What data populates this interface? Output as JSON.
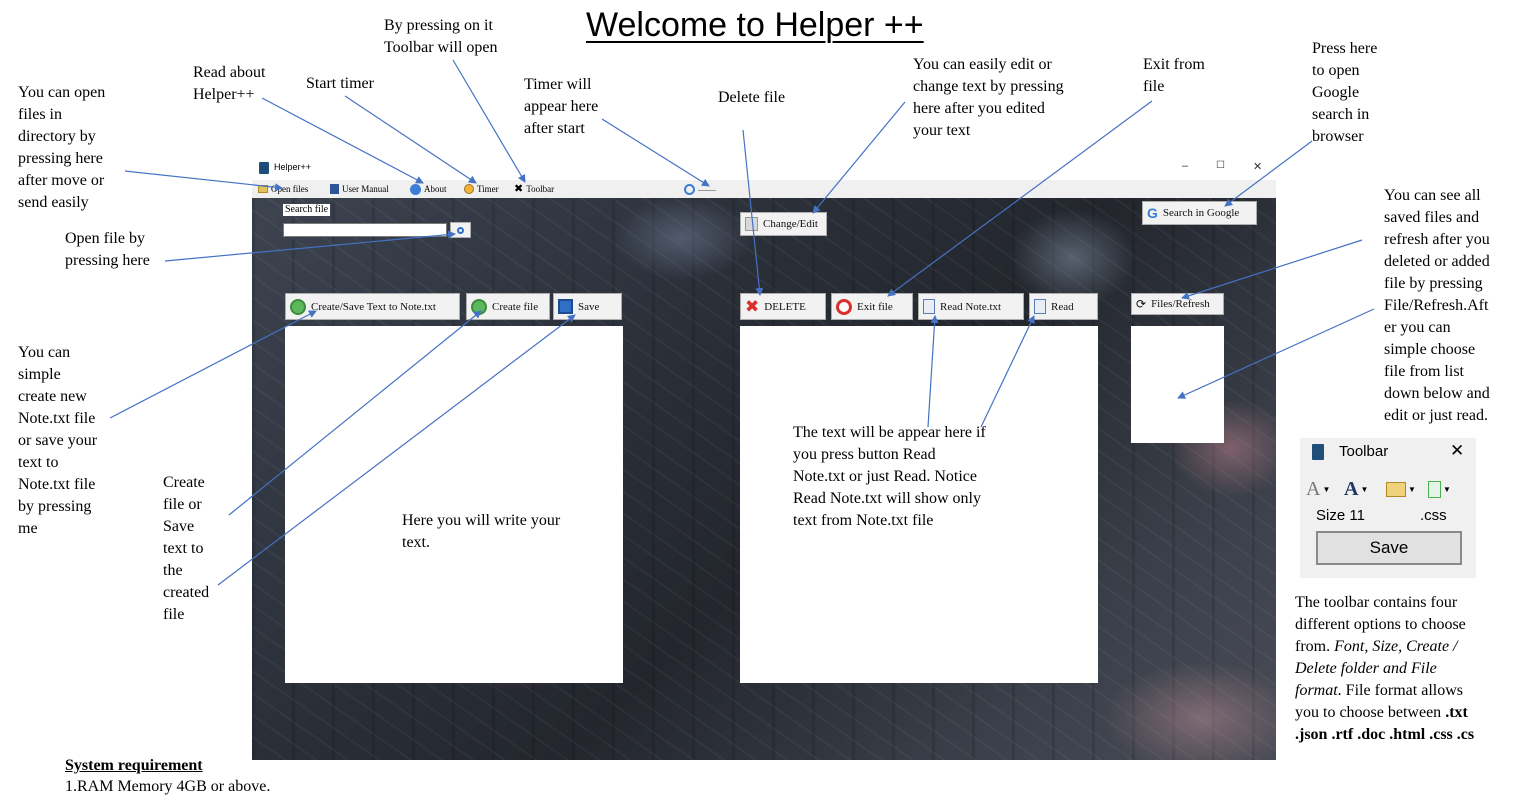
{
  "title": "Welcome to Helper ++",
  "annotations": {
    "toolbar_opens": "By pressing on it\nToolbar will open",
    "read_about": "Read about\nHelper++",
    "start_timer": "Start timer",
    "timer_appears": "Timer will\nappear here\nafter start",
    "delete_file": "Delete file",
    "change_edit": "You can easily edit or\nchange text by pressing\nhere after you edited\nyour text",
    "exit_file": "Exit from\nfile",
    "google": "Press here\nto open\nGoogle\nsearch in\nbrowser",
    "open_files": "You can open\nfiles in\ndirectory by\npressing here\nafter move or\nsend easily",
    "open_file_search": "Open file by\npressing here",
    "saved_files": "You can see all\nsaved files and\nrefresh after you\ndeleted or added\nfile by pressing\nFile/Refresh.Aft\ner you can\nsimple choose\nfile from list\ndown below and\nedit or just read.",
    "create_note": "You can\nsimple\ncreate new\nNote.txt file\nor save your\ntext to\nNote.txt file\nby pressing\nme",
    "create_file": "Create\nfile or\nSave\ntext to\nthe\ncreated\nfile",
    "write_text": "Here you will write your\ntext.",
    "read_text": "The text will be appear here if\nyou press button Read\nNote.txt or just Read. Notice\nRead Note.txt will show only\ntext from Note.txt file"
  },
  "toolbar_description": {
    "line1": "The toolbar contains four",
    "line2": "different options to choose",
    "line3_prefix": "from. ",
    "line3_italic": "Font, Size, Create /",
    "line4_italic": "Delete folder and File",
    "line5_italic": "format",
    "line5_suffix": ". File format allows",
    "line6_prefix": "you to choose between ",
    "line6_bold": ".txt",
    "line7_bold": ".json .rtf .doc .html .css .cs"
  },
  "system_requirement": {
    "heading": "System requirement",
    "item1": "1.RAM Memory 4GB or above."
  },
  "app": {
    "window_title": "Helper++",
    "menu": {
      "open_files": "Open files",
      "user_manual": "User Manual",
      "about": "About",
      "timer": "Timer",
      "toolbar": "Toolbar",
      "timer_placeholder": "........."
    },
    "search_label": "Search file",
    "buttons": {
      "change_edit": "Change/Edit",
      "search_google": "Search in Google",
      "create_save_note": "Create/Save Text to Note.txt",
      "create_file": "Create file",
      "save": "Save",
      "delete": "DELETE",
      "exit_file": "Exit file",
      "read_note": "Read Note.txt",
      "read": "Read",
      "files_refresh": "Files/Refresh"
    },
    "window_controls": {
      "minimize": "–",
      "maximize": "☐",
      "close": "✕"
    }
  },
  "toolbar_window": {
    "title": "Toolbar",
    "close": "✕",
    "size_label": "Size 11",
    "format_label": ".css",
    "save_button": "Save"
  },
  "colors": {
    "button_bg": "#f2f2f2",
    "panel_bg": "#ffffff",
    "arrow": "#4472c4",
    "delete_icon": "#d9302c",
    "exit_icon": "#d9302c",
    "create_icon": "#4caf50"
  }
}
